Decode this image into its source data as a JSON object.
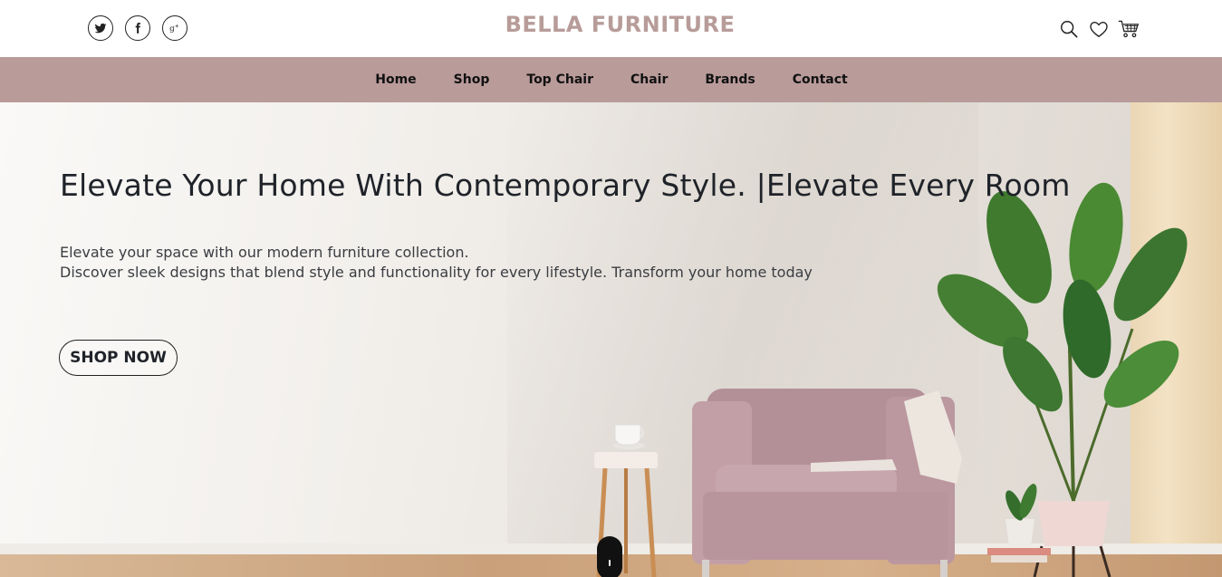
{
  "brand": {
    "name": "BELLA FURNITURE",
    "color": "#b79c99"
  },
  "social": [
    {
      "name": "twitter-icon"
    },
    {
      "name": "facebook-icon"
    },
    {
      "name": "google-plus-icon"
    }
  ],
  "tools": [
    "search-icon",
    "heart-icon",
    "cart-icon"
  ],
  "nav": {
    "background": "#b99b9a",
    "items": [
      "Home",
      "Shop",
      "Top Chair",
      "Chair",
      "Brands",
      "Contact"
    ]
  },
  "hero": {
    "title": "Elevate Your Home With Contemporary Style. |Elevate Every Room",
    "line1": "Elevate your space with our modern furniture collection.",
    "line2": "Discover sleek designs that blend style and functionality for every lifestyle. Transform your home today",
    "cta": "SHOP NOW"
  }
}
